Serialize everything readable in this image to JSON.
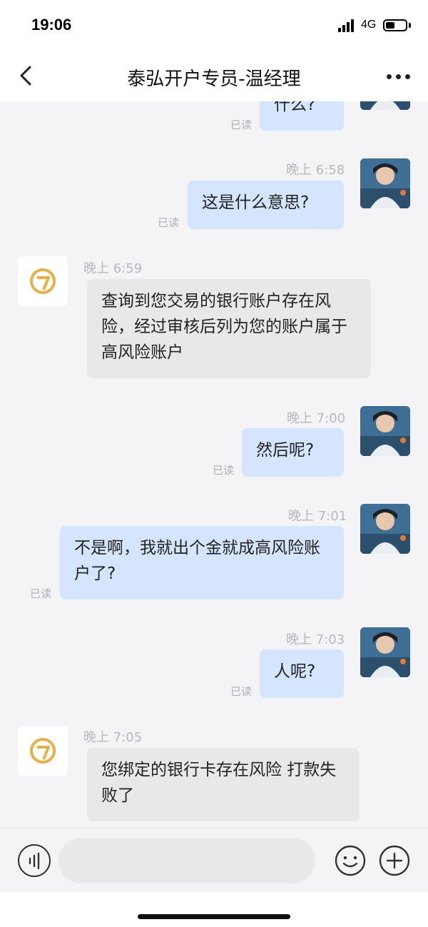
{
  "status_bar": {
    "time": "19:06",
    "network": "4G",
    "battery_level": 0.4
  },
  "nav": {
    "title": "泰弘开户专员-温经理",
    "back_icon": "chevron-left-icon",
    "more_icon": "more-dots-icon"
  },
  "messages": [
    {
      "from": "me",
      "time": "",
      "text": "什么?",
      "read": "已读"
    },
    {
      "from": "me",
      "time": "晚上 6:58",
      "text": "这是什么意思?",
      "read": "已读"
    },
    {
      "from": "agent",
      "time": "晚上 6:59",
      "text": "查询到您交易的银行账户存在风险，经过审核后列为您的账户属于高风险账户"
    },
    {
      "from": "me",
      "time": "晚上 7:00",
      "text": "然后呢?",
      "read": "已读"
    },
    {
      "from": "me",
      "time": "晚上 7:01",
      "text": "不是啊，我就出个金就成高风险账户了?",
      "read": "已读"
    },
    {
      "from": "me",
      "time": "晚上 7:03",
      "text": "人呢?",
      "read": "已读"
    },
    {
      "from": "agent",
      "time": "晚上 7:05",
      "text": "您绑定的银行卡存在风险 打款失败了"
    }
  ],
  "input_bar": {
    "placeholder": "",
    "value": "",
    "voice_icon": "voice-icon",
    "emoji_icon": "emoji-icon",
    "plus_icon": "plus-icon"
  },
  "colors": {
    "my_bubble": "#d4e5fd",
    "agent_bubble": "#e8e8ea",
    "logo_gold": "#e5b047",
    "background": "#f4f4f6"
  }
}
